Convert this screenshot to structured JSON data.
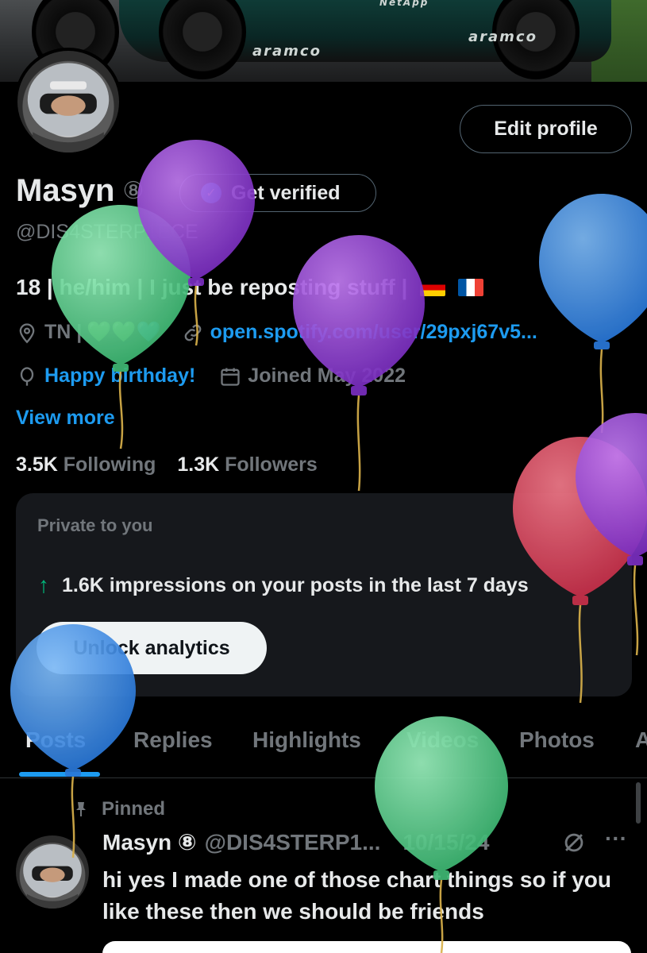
{
  "header": {
    "banner_sponsors": [
      "NetApp",
      "aramco",
      "aramco"
    ]
  },
  "profile": {
    "edit_button": "Edit profile",
    "display_name": "Masyn",
    "badge": "⑧",
    "get_verified": "Get verified",
    "handle": "@DIS4STERP1ECE",
    "bio_text": "18 | he/him | I just be reposting stuff |",
    "location": "TN |",
    "location_hearts": "💚💚💙",
    "website": "open.spotify.com/user/29pxj67v5...",
    "birthday": "Happy birthday!",
    "joined": "Joined May 2022",
    "view_more": "View more",
    "following_count": "3.5K",
    "following_label": "Following",
    "followers_count": "1.3K",
    "followers_label": "Followers"
  },
  "analytics_card": {
    "private_label": "Private to you",
    "close_icon": "×",
    "impressions_text": "1.6K impressions on your posts in the last 7 days",
    "unlock_button": "Unlock analytics",
    "accent": "#00ba7c"
  },
  "tabs": [
    {
      "label": "Posts",
      "active": true
    },
    {
      "label": "Replies",
      "active": false
    },
    {
      "label": "Highlights",
      "active": false
    },
    {
      "label": "Videos",
      "active": false
    },
    {
      "label": "Photos",
      "active": false
    },
    {
      "label": "A",
      "active": false
    }
  ],
  "pinned_post": {
    "pinned_label": "Pinned",
    "author_name": "Masyn ⑧",
    "author_handle": "@DIS4STERP1...",
    "date": "10/15/24",
    "more": "···",
    "text": "hi yes I made one of those chart things so if you like these then we should be friends"
  },
  "colors": {
    "accent_blue": "#1d9bf0",
    "muted": "#71767b",
    "background": "#000000",
    "balloon_green": "#5fd08f",
    "balloon_purple": "#8e3fd1",
    "balloon_blue": "#3d8ee6",
    "balloon_red": "#e0455a"
  },
  "icons": {
    "location": "location-pin-icon",
    "link": "link-icon",
    "birthday": "balloon-icon",
    "calendar": "calendar-icon",
    "pin": "pin-icon",
    "grok": "grok-icon",
    "verified": "verified-check-icon",
    "arrow_up": "arrow-up-icon"
  }
}
